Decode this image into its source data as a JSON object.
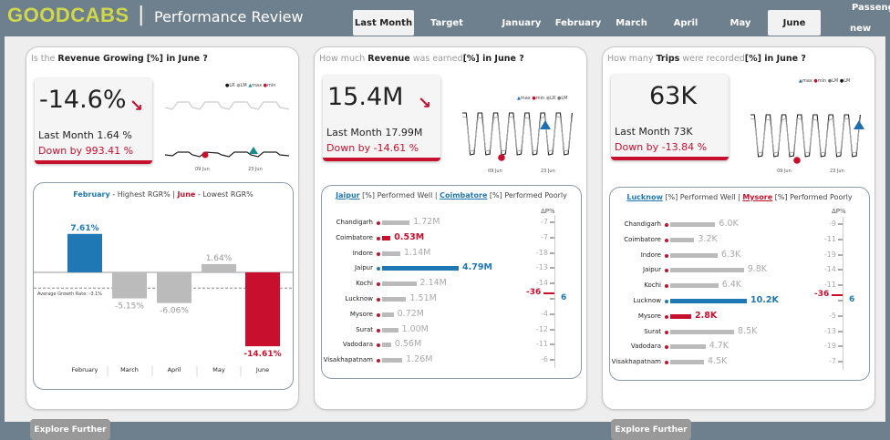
{
  "header": {
    "brand": "GOODCABS",
    "separator": "|",
    "title": "Performance Review",
    "tabs": [
      {
        "label": "Last Month",
        "active": true
      },
      {
        "label": "Target",
        "active": false
      },
      {
        "label": "January",
        "active": false
      },
      {
        "label": "February",
        "active": false
      },
      {
        "label": "March",
        "active": false
      },
      {
        "label": "April",
        "active": false
      },
      {
        "label": "May",
        "active": false
      },
      {
        "label": "June",
        "active": true
      }
    ],
    "extra_tab_line1": "Passeng",
    "extra_tab_line2": "new"
  },
  "colors": {
    "brand": "#cfd84a",
    "accent_red": "#c8102e",
    "accent_blue": "#1f77b4",
    "bar_grey": "#bbbbbb",
    "topbar": "#6e7f8d"
  },
  "panels": [
    {
      "question_pre": "Is the ",
      "question_bold": "Revenue Growing",
      "question_mid": "[%]",
      "question_in": " in ",
      "question_month": "June",
      "question_end": " ?",
      "kpi": {
        "value": "-14.6%",
        "last_month": "Last Month ",
        "last_month_val": "1.64 %",
        "down": "Down by 993.41 %"
      },
      "legend": [
        "LR",
        "LM",
        "max",
        "min"
      ],
      "spark_ticks": [
        "09 Jun",
        "23 Jun"
      ],
      "inner": {
        "hi_month": "February",
        "hi_text": " - Highest RGR% | ",
        "lo_month": "June",
        "lo_text": " - Lowest RGR%",
        "avg_label": "Average Growth Rate: -3.1%"
      },
      "explore": "Explore Further"
    },
    {
      "question_pre": "How much ",
      "question_bold": "Revenue",
      "question_mid": " was earned",
      "question_tag": "[%]",
      "question_in": " in ",
      "question_month": "June",
      "question_end": " ?",
      "kpi": {
        "value": "15.4M",
        "last_month": "Last Month ",
        "last_month_val": "17.99M",
        "down": "Down by -14.61 %"
      },
      "legend": [
        "max",
        "min",
        "LR",
        "LM"
      ],
      "spark_ticks": [
        "09 Jun",
        "23 Jun"
      ],
      "inner": {
        "good_city": "Jaipur",
        "good_text": " Performed Well | ",
        "bad_city": "Coimbatore",
        "bad_text": " Performed Poorly",
        "delta_header": "ΔP%",
        "tag": "[%]"
      }
    },
    {
      "question_pre": "How many ",
      "question_bold": "Trips",
      "question_mid": " were recorded",
      "question_tag": "[%]",
      "question_in": " in ",
      "question_month": "June",
      "question_end": " ?",
      "kpi": {
        "value": "63K",
        "last_month": "Last Month ",
        "last_month_val": "73K",
        "down": "Down by -13.84 %"
      },
      "legend": [
        "max",
        "min",
        "LM",
        "LM"
      ],
      "spark_ticks": [
        "09 Jun",
        "23 Jun"
      ],
      "inner": {
        "good_city": "Lucknow",
        "good_text": " Performed Well | ",
        "bad_city": "Mysore",
        "bad_text": " Performed Poorly",
        "delta_header": "ΔP%",
        "tag": "[%]"
      },
      "explore": "Explore Further"
    }
  ],
  "chart_data": [
    {
      "type": "bar",
      "title": "",
      "categories": [
        "February",
        "March",
        "April",
        "May",
        "June"
      ],
      "values": [
        7.61,
        -5.15,
        -6.06,
        1.64,
        -14.61
      ],
      "value_labels": [
        "7.61%",
        "-5.15%",
        "-6.06%",
        "1.64%",
        "-14.61%"
      ],
      "reference_line": -3.1,
      "ylim": [
        -17,
        10
      ]
    },
    {
      "type": "bar",
      "orientation": "horizontal",
      "categories": [
        "Chandigarh",
        "Coimbatore",
        "Indore",
        "Jaipur",
        "Kochi",
        "Lucknow",
        "Mysore",
        "Surat",
        "Vadodara",
        "Visakhapatnam"
      ],
      "values": [
        1.72,
        0.53,
        1.14,
        4.79,
        2.14,
        1.51,
        0.72,
        1.0,
        0.56,
        1.26
      ],
      "value_labels": [
        "1.72M",
        "0.53M",
        "1.14M",
        "4.79M",
        "2.14M",
        "1.51M",
        "0.72M",
        "1.00M",
        "0.56M",
        "1.26M"
      ],
      "delta_labels": [
        "-7",
        "-6",
        "-18",
        "-13",
        "-14",
        "6",
        "-4",
        "-12",
        "-11",
        "-6"
      ],
      "delta_values": [
        -7,
        -36,
        -18,
        -13,
        -14,
        6,
        -4,
        -12,
        -11,
        -6
      ],
      "delta_extremes": [
        "-36",
        "6"
      ]
    },
    {
      "type": "bar",
      "orientation": "horizontal",
      "categories": [
        "Chandigarh",
        "Coimbatore",
        "Indore",
        "Jaipur",
        "Kochi",
        "Lucknow",
        "Mysore",
        "Surat",
        "Vadodara",
        "Visakhapatnam"
      ],
      "values": [
        6.0,
        3.2,
        6.3,
        9.8,
        6.4,
        10.2,
        2.8,
        8.5,
        4.7,
        4.5
      ],
      "value_labels": [
        "6.0K",
        "3.2K",
        "6.3K",
        "9.8K",
        "6.4K",
        "10.2K",
        "2.8K",
        "8.5K",
        "4.7K",
        "4.5K"
      ],
      "delta_labels": [
        "-9",
        "-11",
        "-19",
        "-14",
        "-11",
        "6",
        "-5",
        "-13",
        "-19",
        "-7"
      ],
      "delta_values": [
        -9,
        -11,
        -19,
        -14,
        -11,
        6,
        -36,
        -13,
        -19,
        -7
      ],
      "delta_extremes": [
        "-36",
        "6"
      ]
    }
  ]
}
